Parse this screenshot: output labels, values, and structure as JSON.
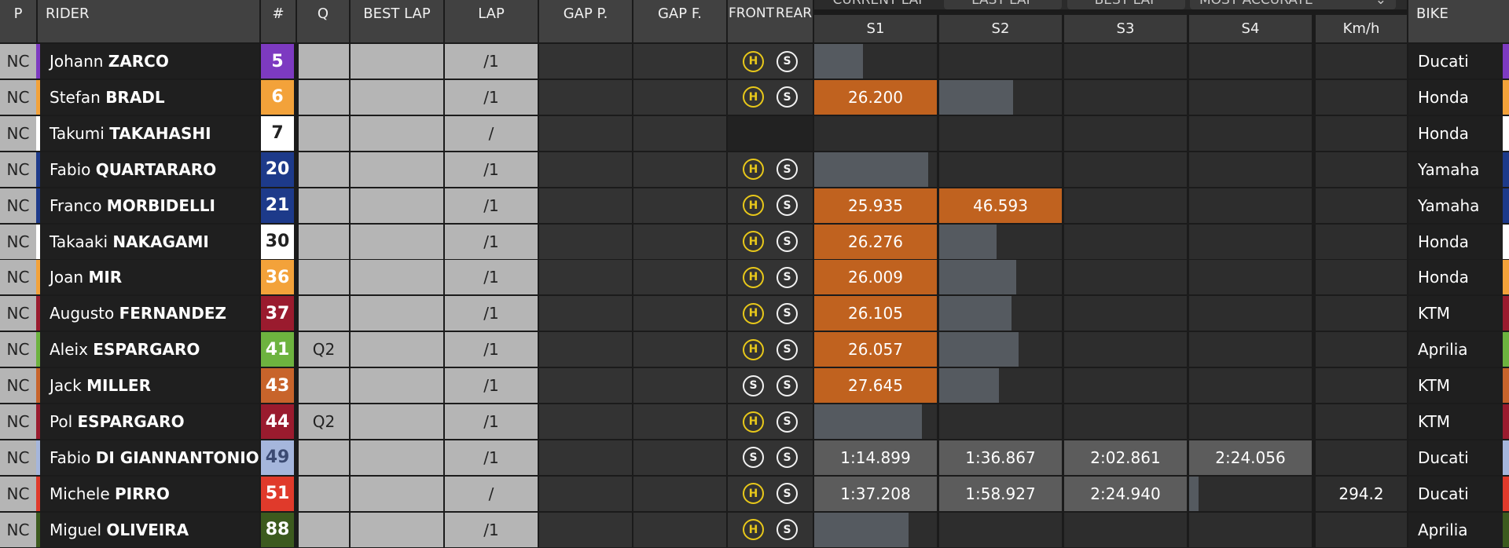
{
  "header": {
    "p": "P",
    "rider": "RIDER",
    "num": "#",
    "q": "Q",
    "best_lap": "BEST LAP",
    "lap": "LAP",
    "gap_p": "GAP P.",
    "gap_f": "GAP F.",
    "front": "FRONT",
    "rear": "REAR",
    "tabs": [
      "CURRENT LAP",
      "LAST LAP",
      "BEST LAP"
    ],
    "dropdown": "MOST ACCURATE",
    "s1": "S1",
    "s2": "S2",
    "s3": "S3",
    "s4": "S4",
    "kmh": "Km/h",
    "bike": "BIKE"
  },
  "colors": {
    "orange_sector": "#c0621f",
    "grey_sector": "#5c5c5c",
    "hard_tyre": "#e8c81a",
    "soft_tyre": "#f2f2f2"
  },
  "riders": [
    {
      "pos": "NC",
      "first": "Johann",
      "last": "ZARCO",
      "num": "5",
      "num_bg": "#7d3ac1",
      "num_fg": "#ffffff",
      "team_color": "#7d3ac1",
      "q": "",
      "lap": "/1",
      "front": "H",
      "rear": "S",
      "s1": "",
      "s2": "",
      "s3": "",
      "s4": "",
      "kmh": "",
      "bike": "Ducati",
      "bike_color": "#7d3ac1",
      "progress_sector": 1,
      "progress": 0.4
    },
    {
      "pos": "NC",
      "first": "Stefan",
      "last": "BRADL",
      "num": "6",
      "num_bg": "#f3a23a",
      "num_fg": "#ffffff",
      "team_color": "#f3a23a",
      "q": "",
      "lap": "/1",
      "front": "H",
      "rear": "S",
      "s1": "26.200",
      "s1c": "orange",
      "s2": "",
      "s3": "",
      "s4": "",
      "kmh": "",
      "bike": "Honda",
      "bike_color": "#f3a23a",
      "progress_sector": 2,
      "progress": 0.6
    },
    {
      "pos": "NC",
      "first": "Takumi",
      "last": "TAKAHASHI",
      "num": "7",
      "num_bg": "#ffffff",
      "num_fg": "#222222",
      "team_color": "#ffffff",
      "q": "",
      "lap": "/",
      "front": "",
      "rear": "",
      "s1": "",
      "s2": "",
      "s3": "",
      "s4": "",
      "kmh": "",
      "bike": "Honda",
      "bike_color": "#ffffff",
      "progress_sector": 0,
      "progress": 0
    },
    {
      "pos": "NC",
      "first": "Fabio",
      "last": "QUARTARARO",
      "num": "20",
      "num_bg": "#1d3a8a",
      "num_fg": "#ffffff",
      "team_color": "#1d3a8a",
      "q": "",
      "lap": "/1",
      "front": "H",
      "rear": "S",
      "s1": "",
      "s2": "",
      "s3": "",
      "s4": "",
      "kmh": "",
      "bike": "Yamaha",
      "bike_color": "#1d3a8a",
      "progress_sector": 1,
      "progress": 0.93
    },
    {
      "pos": "NC",
      "first": "Franco",
      "last": "MORBIDELLI",
      "num": "21",
      "num_bg": "#1d3a8a",
      "num_fg": "#ffffff",
      "team_color": "#1d3a8a",
      "q": "",
      "lap": "/1",
      "front": "H",
      "rear": "S",
      "s1": "25.935",
      "s1c": "orange",
      "s2": "46.593",
      "s2c": "orange",
      "s3": "",
      "s4": "",
      "kmh": "",
      "bike": "Yamaha",
      "bike_color": "#1d3a8a",
      "progress_sector": 0,
      "progress": 0
    },
    {
      "pos": "NC",
      "first": "Takaaki",
      "last": "NAKAGAMI",
      "num": "30",
      "num_bg": "#ffffff",
      "num_fg": "#222222",
      "team_color": "#ffffff",
      "q": "",
      "lap": "/1",
      "front": "H",
      "rear": "S",
      "s1": "26.276",
      "s1c": "orange",
      "s2": "",
      "s3": "",
      "s4": "",
      "kmh": "",
      "bike": "Honda",
      "bike_color": "#ffffff",
      "progress_sector": 2,
      "progress": 0.47
    },
    {
      "pos": "NC",
      "first": "Joan",
      "last": "MIR",
      "num": "36",
      "num_bg": "#f3a23a",
      "num_fg": "#ffffff",
      "team_color": "#f3a23a",
      "q": "",
      "lap": "/1",
      "front": "H",
      "rear": "S",
      "s1": "26.009",
      "s1c": "orange",
      "s2": "",
      "s3": "",
      "s4": "",
      "kmh": "",
      "bike": "Honda",
      "bike_color": "#f3a23a",
      "progress_sector": 2,
      "progress": 0.63
    },
    {
      "pos": "NC",
      "first": "Augusto",
      "last": "FERNANDEZ",
      "num": "37",
      "num_bg": "#9a1b2e",
      "num_fg": "#ffffff",
      "team_color": "#9a1b2e",
      "q": "",
      "lap": "/1",
      "front": "H",
      "rear": "S",
      "s1": "26.105",
      "s1c": "orange",
      "s2": "",
      "s3": "",
      "s4": "",
      "kmh": "",
      "bike": "KTM",
      "bike_color": "#9a1b2e",
      "progress_sector": 2,
      "progress": 0.59
    },
    {
      "pos": "NC",
      "first": "Aleix",
      "last": "ESPARGARO",
      "num": "41",
      "num_bg": "#6db33f",
      "num_fg": "#ffffff",
      "team_color": "#6db33f",
      "q": "Q2",
      "lap": "/1",
      "front": "H",
      "rear": "S",
      "s1": "26.057",
      "s1c": "orange",
      "s2": "",
      "s3": "",
      "s4": "",
      "kmh": "",
      "bike": "Aprilia",
      "bike_color": "#6db33f",
      "progress_sector": 2,
      "progress": 0.65
    },
    {
      "pos": "NC",
      "first": "Jack",
      "last": "MILLER",
      "num": "43",
      "num_bg": "#c8642b",
      "num_fg": "#ffffff",
      "team_color": "#c8642b",
      "q": "",
      "lap": "/1",
      "front": "S",
      "rear": "S",
      "s1": "27.645",
      "s1c": "orange",
      "s2": "",
      "s3": "",
      "s4": "",
      "kmh": "",
      "bike": "KTM",
      "bike_color": "#c8642b",
      "progress_sector": 2,
      "progress": 0.49
    },
    {
      "pos": "NC",
      "first": "Pol",
      "last": "ESPARGARO",
      "num": "44",
      "num_bg": "#9a1b2e",
      "num_fg": "#ffffff",
      "team_color": "#9a1b2e",
      "q": "Q2",
      "lap": "/1",
      "front": "H",
      "rear": "S",
      "s1": "",
      "s2": "",
      "s3": "",
      "s4": "",
      "kmh": "",
      "bike": "KTM",
      "bike_color": "#9a1b2e",
      "progress_sector": 1,
      "progress": 0.88
    },
    {
      "pos": "NC",
      "first": "Fabio",
      "last": "DI GIANNANTONIO",
      "num": "49",
      "num_bg": "#a5b6dc",
      "num_fg": "#3b4a72",
      "team_color": "#a5b6dc",
      "q": "",
      "lap": "/1",
      "front": "S",
      "rear": "S",
      "s1": "1:14.899",
      "s1c": "grey",
      "s2": "1:36.867",
      "s2c": "grey",
      "s3": "2:02.861",
      "s3c": "grey",
      "s4": "2:24.056",
      "s4c": "grey",
      "kmh": "",
      "bike": "Ducati",
      "bike_color": "#a5b6dc",
      "progress_sector": 0,
      "progress": 0
    },
    {
      "pos": "NC",
      "first": "Michele",
      "last": "PIRRO",
      "num": "51",
      "num_bg": "#e03a2b",
      "num_fg": "#ffffff",
      "team_color": "#e03a2b",
      "q": "",
      "lap": "/",
      "front": "H",
      "rear": "S",
      "s1": "1:37.208",
      "s1c": "grey",
      "s2": "1:58.927",
      "s2c": "grey",
      "s3": "2:24.940",
      "s3c": "grey",
      "s4": "",
      "kmh": "294.2",
      "bike": "Ducati",
      "bike_color": "#e03a2b",
      "progress_sector": 4,
      "progress": 0.08
    },
    {
      "pos": "NC",
      "first": "Miguel",
      "last": "OLIVEIRA",
      "num": "88",
      "num_bg": "#3c5a1e",
      "num_fg": "#ffffff",
      "team_color": "#3c5a1e",
      "q": "",
      "lap": "/1",
      "front": "H",
      "rear": "S",
      "s1": "",
      "s2": "",
      "s3": "",
      "s4": "",
      "kmh": "",
      "bike": "Aprilia",
      "bike_color": "#3c5a1e",
      "progress_sector": 1,
      "progress": 0.77
    }
  ]
}
